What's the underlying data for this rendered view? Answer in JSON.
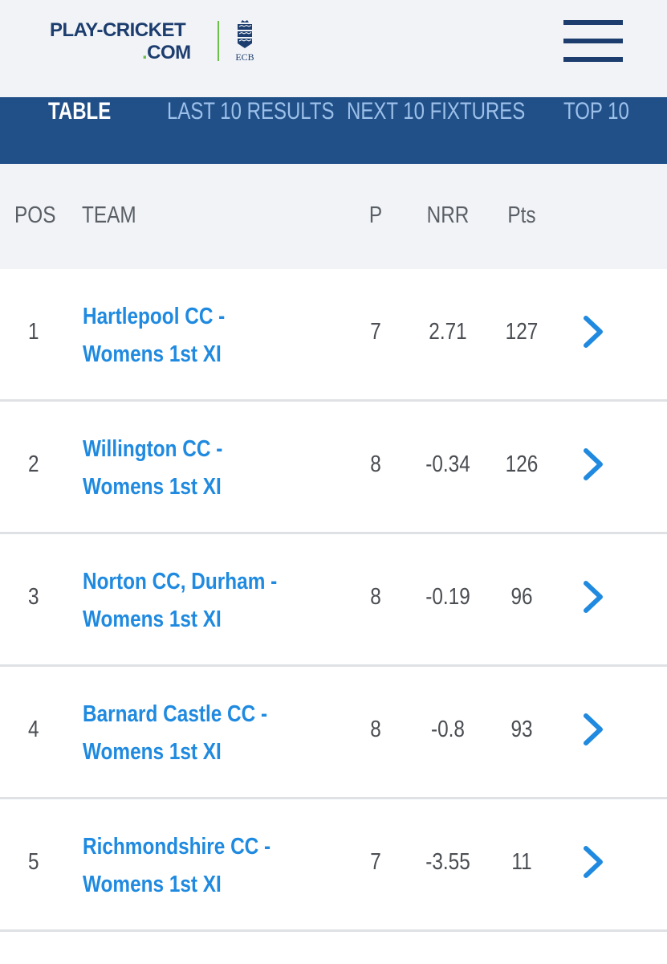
{
  "brand": {
    "line1": "PLAY-CRICKET",
    "dot": ".",
    "line2": "COM",
    "ecb_text": "ECB",
    "green": "#6cc04a",
    "navy": "#1c3d6e"
  },
  "header": {
    "menu_icon": "hamburger-menu-icon"
  },
  "tabs": [
    {
      "label": "TABLE",
      "active": true
    },
    {
      "label": "LAST 10 RESULTS",
      "active": false
    },
    {
      "label": "NEXT 10 FIXTURES",
      "active": false
    },
    {
      "label": "TOP 10",
      "active": false
    }
  ],
  "table": {
    "columns": {
      "pos": "POS",
      "team": "TEAM",
      "p": "P",
      "nrr": "NRR",
      "pts": "Pts"
    },
    "rows": [
      {
        "pos": "1",
        "team_line1": "Hartlepool CC -",
        "team_line2": "Womens 1st XI",
        "p": "7",
        "nrr": "2.71",
        "pts": "127"
      },
      {
        "pos": "2",
        "team_line1": "Willington CC -",
        "team_line2": "Womens 1st XI",
        "p": "8",
        "nrr": "-0.34",
        "pts": "126"
      },
      {
        "pos": "3",
        "team_line1": "Norton CC, Durham -",
        "team_line2": "Womens 1st XI",
        "p": "8",
        "nrr": "-0.19",
        "pts": "96"
      },
      {
        "pos": "4",
        "team_line1": "Barnard Castle CC -",
        "team_line2": "Womens 1st XI",
        "p": "8",
        "nrr": "-0.8",
        "pts": "93"
      },
      {
        "pos": "5",
        "team_line1": "Richmondshire CC -",
        "team_line2": "Womens 1st XI",
        "p": "7",
        "nrr": "-3.55",
        "pts": "11"
      }
    ],
    "row_icon": "chevron-right-icon"
  },
  "colors": {
    "tab_bar": "#215089",
    "tab_inactive": "#9cc0e9",
    "link_blue": "#1f8ae0",
    "header_bg": "#f1f3f7"
  }
}
